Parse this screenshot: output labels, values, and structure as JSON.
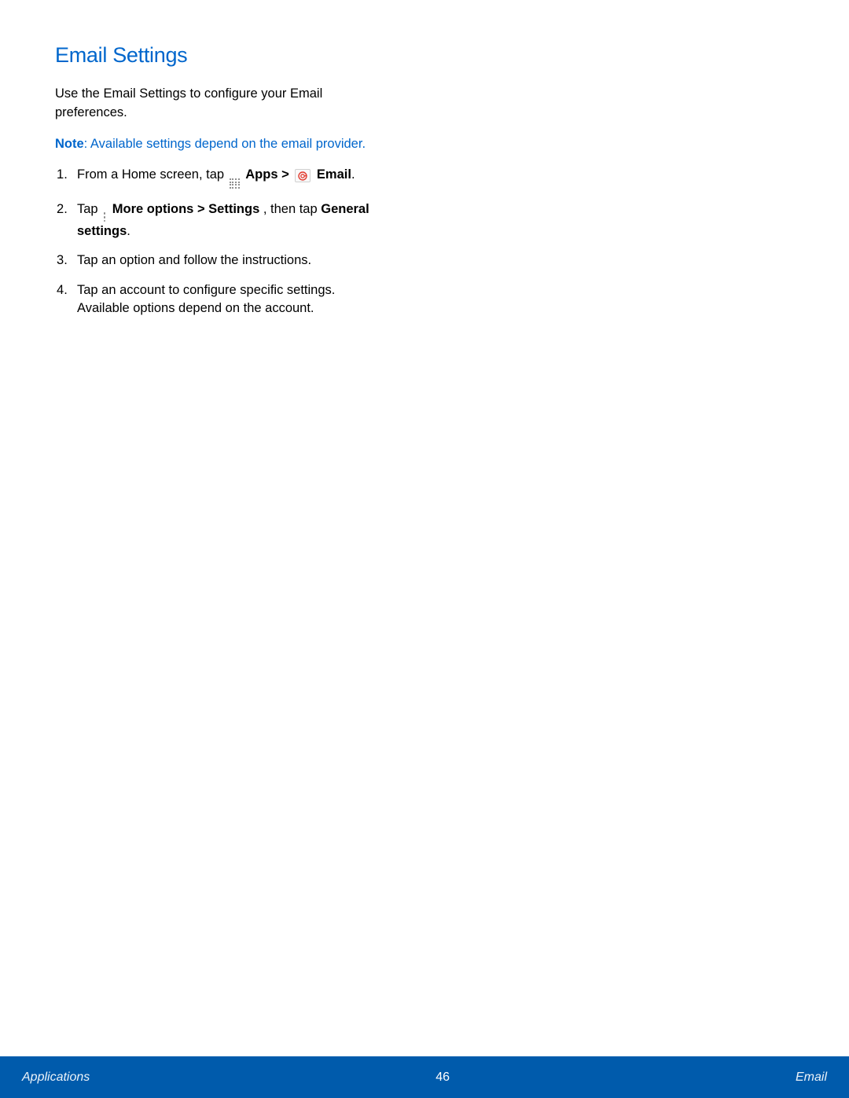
{
  "heading": "Email Settings",
  "intro": "Use the Email Settings to configure your Email preferences.",
  "note": {
    "label": "Note",
    "text": ": Available settings depend on the email provider."
  },
  "steps": {
    "s1": {
      "pre": "From a Home screen, tap ",
      "apps": "Apps > ",
      "email": " Email",
      "period": "."
    },
    "s2": {
      "pre": "Tap ",
      "more": "More options > Settings ",
      "mid": ", then tap ",
      "general": "General settings",
      "period": "."
    },
    "s3": "Tap an option and follow the instructions.",
    "s4": "Tap an account to configure specific settings. Available options depend on the account."
  },
  "footer": {
    "left": "Applications",
    "center": "46",
    "right": "Email"
  }
}
